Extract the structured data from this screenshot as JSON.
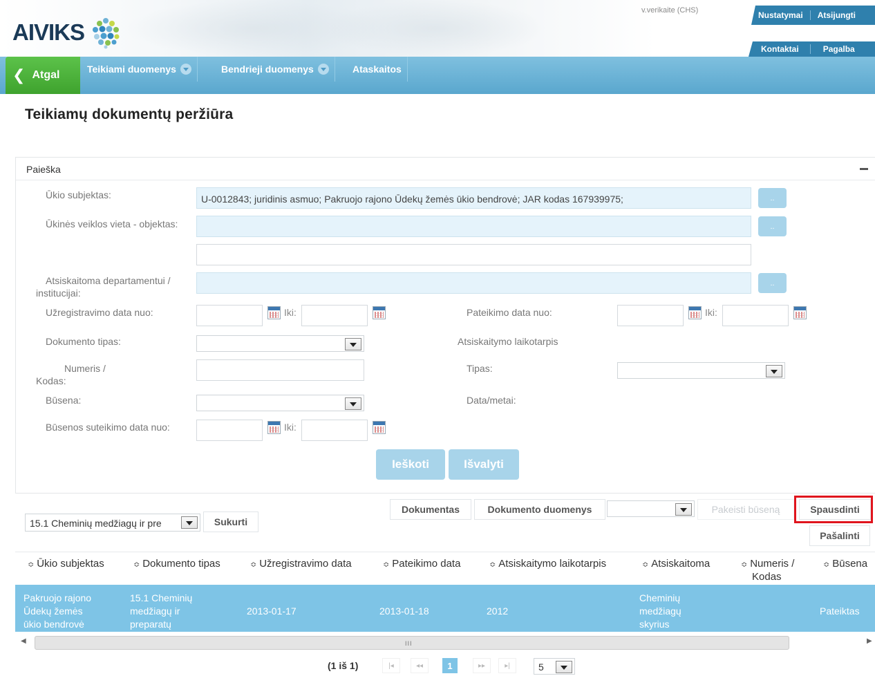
{
  "app": {
    "logo": "AIVIKS",
    "user": "v.verikaite (CHS)",
    "top_links": [
      "Nustatymai",
      "Atsijungti"
    ],
    "top_links_2": [
      "Kontaktai",
      "Pagalba"
    ]
  },
  "nav": {
    "back": "Atgal",
    "items": [
      "Teikiami duomenys",
      "Bendrieji duomenys",
      "Ataskaitos"
    ]
  },
  "page": {
    "title": "Teikiamų dokumentų peržiūra"
  },
  "search": {
    "title": "Paieška",
    "labels": {
      "ukio_subjektas": "Ūkio subjektas:",
      "veiklos_vieta": "Ūkinės veiklos vieta - objektas:",
      "atsiskaitoma_1": "Atsiskaitoma departamentui /",
      "atsiskaitoma_2": "institucijai:",
      "uzreg_nuo": "Užregistravimo data nuo:",
      "iki": "Iki:",
      "pateikimo_nuo": "Pateikimo data nuo:",
      "dok_tipas": "Dokumento tipas:",
      "laikotarpis": "Atsiskaitymo laikotarpis",
      "numeris_1": "Numeris /",
      "numeris_2": "Kodas:",
      "tipas": "Tipas:",
      "busena": "Būsena:",
      "data_metai": "Data/metai:",
      "busenos_nuo": "Būsenos suteikimo data nuo:"
    },
    "values": {
      "ukio_subjektas": "U-0012843; juridinis asmuo; Pakruojo rajono Ūdekų žemės ūkio bendrovė; JAR kodas 167939975;"
    },
    "dots": "..",
    "search_button": "Ieškoti",
    "clear_button": "Išvalyti"
  },
  "toolbar": {
    "template_select": "15.1 Cheminių medžiagų ir pre",
    "create": "Sukurti",
    "document": "Dokumentas",
    "document_data": "Dokumento duomenys",
    "change_status": "Pakeisti būseną",
    "print": "Spausdinti",
    "remove": "Pašalinti"
  },
  "table": {
    "headers": [
      "Ūkio subjektas",
      "Dokumento tipas",
      "Užregistravimo data",
      "Pateikimo data",
      "Atsiskaitymo laikotarpis",
      "Atsiskaitoma",
      "Numeris /",
      "Būsena"
    ],
    "header_numeris_line2": "Kodas",
    "sort_icon": "≎",
    "rows": [
      {
        "subjektas": [
          "Pakruojo rajono",
          "Ūdekų žemės",
          "ūkio bendrovė"
        ],
        "tipas": [
          "15.1 Cheminių",
          "medžiagų ir",
          "preparatų"
        ],
        "uzreg": "2013-01-17",
        "pateikimo": "2013-01-18",
        "laikotarpis": "2012",
        "atsiskaitoma": [
          "Cheminių",
          "medžiagų",
          "skyrius"
        ],
        "numeris": "",
        "busena": "Pateiktas"
      }
    ]
  },
  "pager": {
    "info": "(1 iš 1)",
    "first": "|◂",
    "prev": "◂◂",
    "current": "1",
    "next": "▸▸",
    "last": "▸|",
    "page_size": "5"
  },
  "scroll_grip": "III"
}
